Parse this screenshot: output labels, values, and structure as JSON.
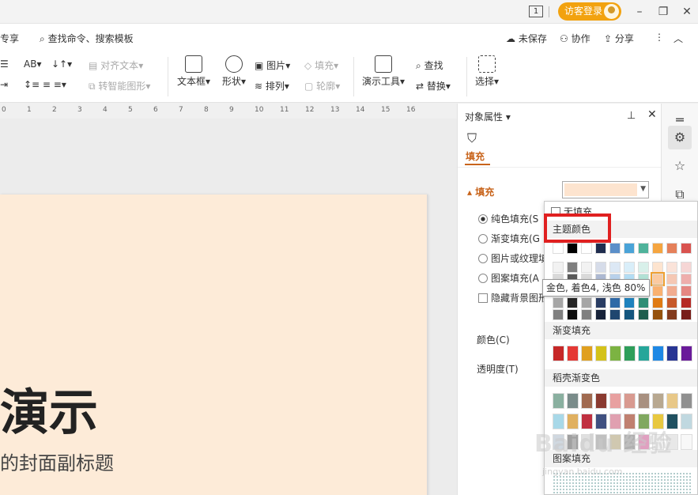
{
  "titlebar": {
    "page_indicator": "1",
    "login_label": "访客登录",
    "window_controls": [
      "minimize-icon",
      "restore-icon",
      "close-icon"
    ]
  },
  "menubar": {
    "left_item": "专享",
    "search_placeholder": "查找命令、搜索模板",
    "unsaved": "未保存",
    "collaborate": "协作",
    "share": "分享"
  },
  "toolbar": {
    "align_text": "对齐文本",
    "smart_shape": "转智能图形",
    "textbox": "文本框",
    "shape": "形状",
    "picture": "图片",
    "arrange": "排列",
    "fill": "填充",
    "outline": "轮廓",
    "presentation_tools": "演示工具",
    "find": "查找",
    "replace": "替换",
    "select": "选择"
  },
  "ruler": {
    "ticks": [
      "0",
      "1",
      "2",
      "3",
      "4",
      "5",
      "6",
      "7",
      "8",
      "9",
      "10",
      "11",
      "12",
      "13",
      "14",
      "15",
      "16"
    ]
  },
  "slide": {
    "title": "演示",
    "subtitle": "的封面副标题"
  },
  "panel": {
    "header": "对象属性",
    "tab_fill": "填充",
    "section_fill": "填充",
    "options": {
      "solid": "纯色填充(S",
      "gradient": "渐变填充(G",
      "picture": "图片或纹理填",
      "pattern": "图案填充(A",
      "hide_bg": "隐藏背景图形"
    },
    "color_label": "颜色(C)",
    "transparency_label": "透明度(T)",
    "current_color": "#fde4cf"
  },
  "dropdown": {
    "no_fill": "无填充",
    "theme_colors_header": "主题颜色",
    "gradient_fill_header": "渐变填充",
    "shell_gradient_header": "稻壳渐变色",
    "pattern_fill_header": "图案填充",
    "tooltip": "金色, 着色4, 浅色 80%",
    "theme_top_row": [
      "#ffffff",
      "#000000",
      "#ffffff",
      "#1f2d4e",
      "#5b8fc9",
      "#4aa3d8",
      "#4fb39b",
      "#f5a540",
      "#e5805a",
      "#d9534f"
    ],
    "theme_rows": [
      [
        "#f2f2f2",
        "#7f7f7f",
        "#f2f2f2",
        "#d6dce9",
        "#dce8f5",
        "#d9eef9",
        "#d8f0ea",
        "#fde4cf",
        "#fae3d9",
        "#f6d6d5"
      ],
      [
        "#d9d9d9",
        "#595959",
        "#d9d9d9",
        "#adb9d2",
        "#b9d1eb",
        "#b4ddf4",
        "#b2e1d5",
        "#fbcaa0",
        "#f5c8b4",
        "#eeaeac"
      ],
      [
        "#bfbfbf",
        "#404040",
        "#bfbfbf",
        "#8596bb",
        "#96bae1",
        "#8fcdef",
        "#8cd2c0",
        "#f9b170",
        "#f1ac8f",
        "#e58682"
      ],
      [
        "#a6a6a6",
        "#262626",
        "#a6a6a6",
        "#2a3d63",
        "#2f6aa7",
        "#1f82bd",
        "#2f8e76",
        "#e07b14",
        "#c75a2b",
        "#b52b26"
      ],
      [
        "#808080",
        "#0d0d0d",
        "#808080",
        "#18233a",
        "#1f466f",
        "#14567e",
        "#1f5e4e",
        "#95520d",
        "#843c1d",
        "#781d19"
      ]
    ],
    "gradient_row": [
      "#c62828",
      "#e53935",
      "#e0a020",
      "#d4c21a",
      "#7cb342",
      "#2e9e5a",
      "#26a69a",
      "#1e88e5",
      "#283593",
      "#6a1b9a"
    ],
    "shell_rows": [
      [
        "#8ab0a0",
        "#7a8c8a",
        "#a06a50",
        "#8a3a30",
        "#e8a0a0",
        "#d89a90",
        "#a89080",
        "#b8a890",
        "#e8c888",
        "#909090"
      ],
      [
        "#a8d8e8",
        "#e0b060",
        "#c03040",
        "#405080",
        "#e0a0b0",
        "#c08070",
        "#80a860",
        "#e8c840",
        "#205060",
        "#c0d8e0"
      ],
      [
        "#d0d8e0",
        "#a0a0a0",
        "#e0e0e0",
        "#c0c0c0",
        "#d0c8b0",
        "#b0b0b0",
        "#e0a0c0",
        "#f0f0f0",
        "#e8e8e8",
        "#f8f8f8"
      ]
    ],
    "selected_theme_color": "#fbcaa0"
  },
  "watermark": {
    "brand": "Baidu 经验",
    "url": "jingyan.baidu.com"
  }
}
